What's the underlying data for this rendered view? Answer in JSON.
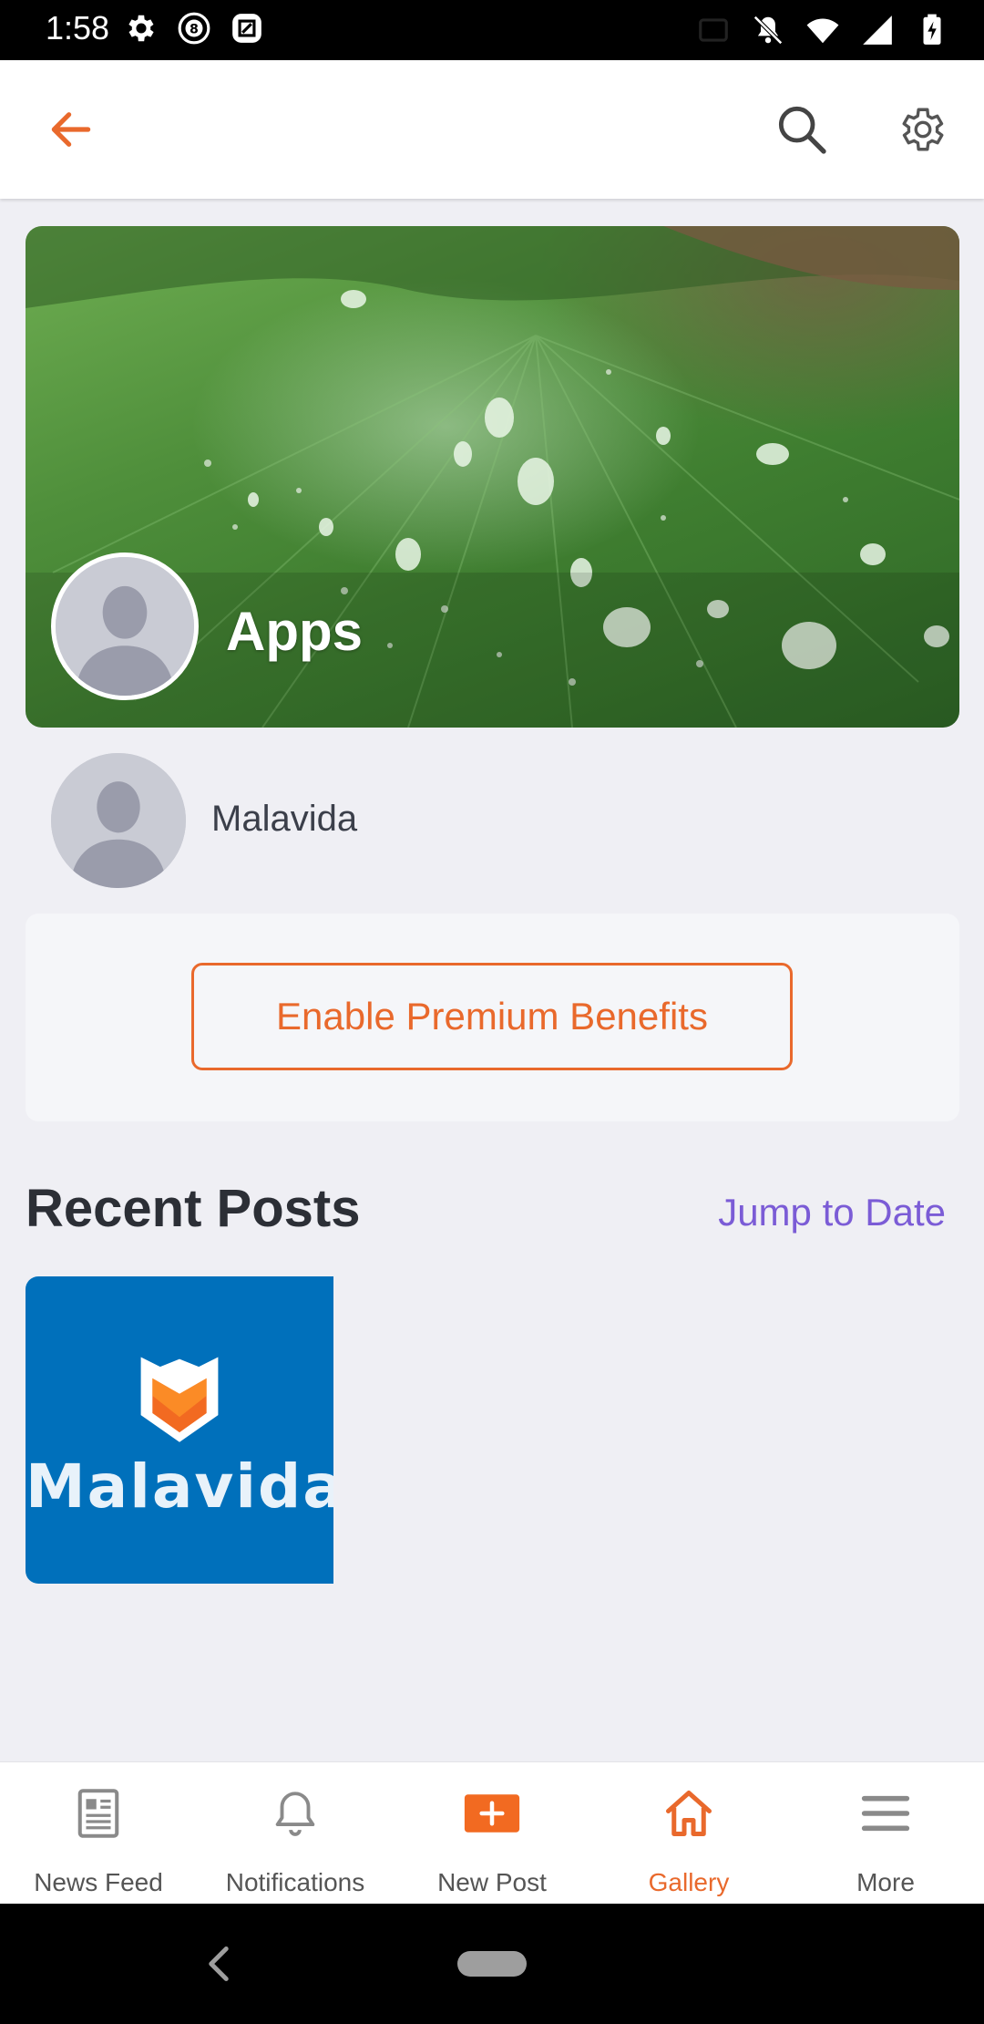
{
  "status_bar": {
    "time": "1:58",
    "left_icons": [
      "gear-icon",
      "circle-8-icon",
      "square-icon"
    ],
    "right_icons": [
      "cast-icon",
      "bell-off-icon",
      "wifi-icon",
      "signal-icon",
      "battery-charging-icon"
    ]
  },
  "app_bar": {
    "back_icon": "arrow-left-icon",
    "search_icon": "search-icon",
    "settings_icon": "gear-icon",
    "accent": "#e9692c"
  },
  "cover": {
    "title": "Apps"
  },
  "owner": {
    "name": "Malavida"
  },
  "premium": {
    "button_label": "Enable Premium Benefits"
  },
  "recent_posts": {
    "title": "Recent Posts",
    "jump_link": "Jump to Date",
    "posts": [
      {
        "brand_text": "Malavida"
      }
    ]
  },
  "bottom_nav": {
    "items": [
      {
        "label": "News Feed",
        "icon": "newspaper-icon",
        "active": false
      },
      {
        "label": "Notifications",
        "icon": "bell-icon",
        "active": false
      },
      {
        "label": "New Post",
        "icon": "plus-box-icon",
        "active": false
      },
      {
        "label": "Gallery",
        "icon": "home-icon",
        "active": true
      },
      {
        "label": "More",
        "icon": "menu-icon",
        "active": false
      }
    ]
  },
  "colors": {
    "accent": "#e9692c",
    "link": "#7b5cd6",
    "background": "#efeff4"
  }
}
